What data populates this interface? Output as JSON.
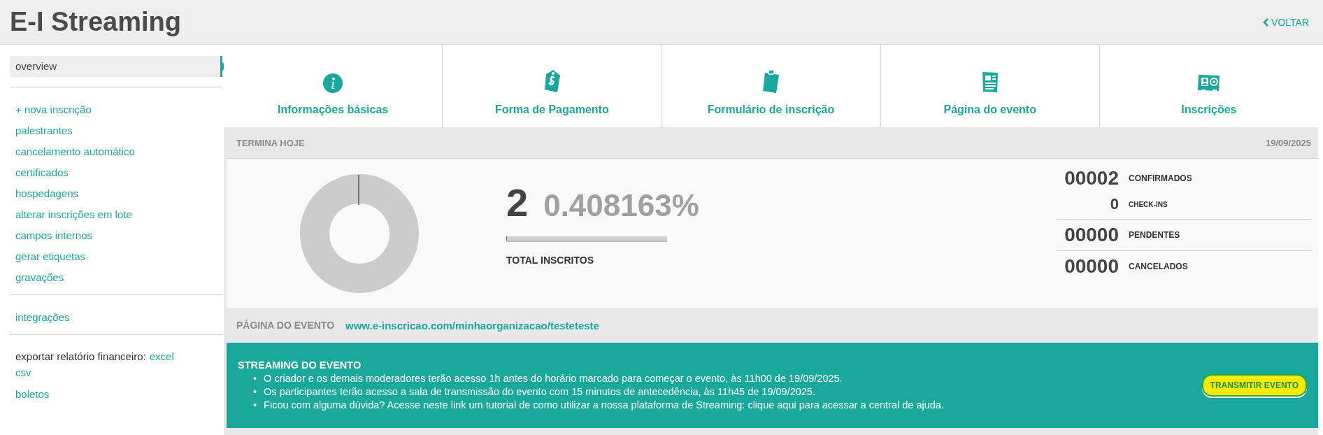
{
  "header": {
    "title": "E-I Streaming",
    "back_link": "VOLTAR"
  },
  "sidebar": {
    "sections": [
      {
        "items": [
          {
            "label": "overview",
            "selected": true
          }
        ]
      },
      {
        "items": [
          {
            "label": "+ nova inscrição",
            "selected": false
          },
          {
            "label": "palestrantes",
            "selected": false
          },
          {
            "label": "cancelamento automático",
            "selected": false
          },
          {
            "label": "certificados",
            "selected": false
          },
          {
            "label": "hospedagens",
            "selected": false
          },
          {
            "label": "alterar inscrições em lote",
            "selected": false
          },
          {
            "label": "campos internos",
            "selected": false
          },
          {
            "label": "gerar etiquetas",
            "selected": false
          },
          {
            "label": "gravações",
            "selected": false
          }
        ]
      },
      {
        "items": [
          {
            "label": "integrações",
            "selected": false
          }
        ]
      }
    ],
    "export": {
      "label": "exportar relatório financeiro:",
      "links": [
        "excel",
        "csv"
      ]
    },
    "extra_link": "boletos"
  },
  "tabs": [
    {
      "label": "Informações básicas"
    },
    {
      "label": "Forma de Pagamento"
    },
    {
      "label": "Formulário de inscrição"
    },
    {
      "label": "Página do evento"
    },
    {
      "label": "Inscrições"
    }
  ],
  "status_bar": {
    "label": "TERMINA HOJE",
    "date": "19/09/2025"
  },
  "summary": {
    "total": "2",
    "percent": "0.408163%",
    "level": 0.004,
    "label": "TOTAL INSCRITOS"
  },
  "counts": [
    {
      "kind": "main",
      "value": "00002",
      "label": "CONFIRMADOS"
    },
    {
      "kind": "sub",
      "value": "0",
      "label": "CHECK-INS"
    },
    {
      "kind": "main",
      "value": "00000",
      "label": "PENDENTES"
    },
    {
      "kind": "main",
      "value": "00000",
      "label": "CANCELADOS"
    }
  ],
  "event_page": {
    "label": "PÁGINA DO EVENTO",
    "url": "www.e-inscricao.com/minhaorganizacao/testeteste"
  },
  "streaming": {
    "title": "STREAMING DO EVENTO",
    "bullets": [
      {
        "marker": "•",
        "text": "O criador e os demais moderadores terão acesso 1h antes do horário marcado para começar o evento, às 11h00 de 19/09/2025."
      },
      {
        "marker": "•",
        "text": "Os participantes terão acesso a sala de transmissão do evento com 15 minutos de antecedência, às 11h45 de 19/09/2025."
      },
      {
        "marker": "•",
        "text": "Ficou com alguma dúvida? Acesse neste link um tutorial de como utilizar a nossa plataforma de Streaming: clique aqui para acessar a central de ajuda."
      }
    ],
    "button": "TRANSMITIR EVENTO"
  }
}
